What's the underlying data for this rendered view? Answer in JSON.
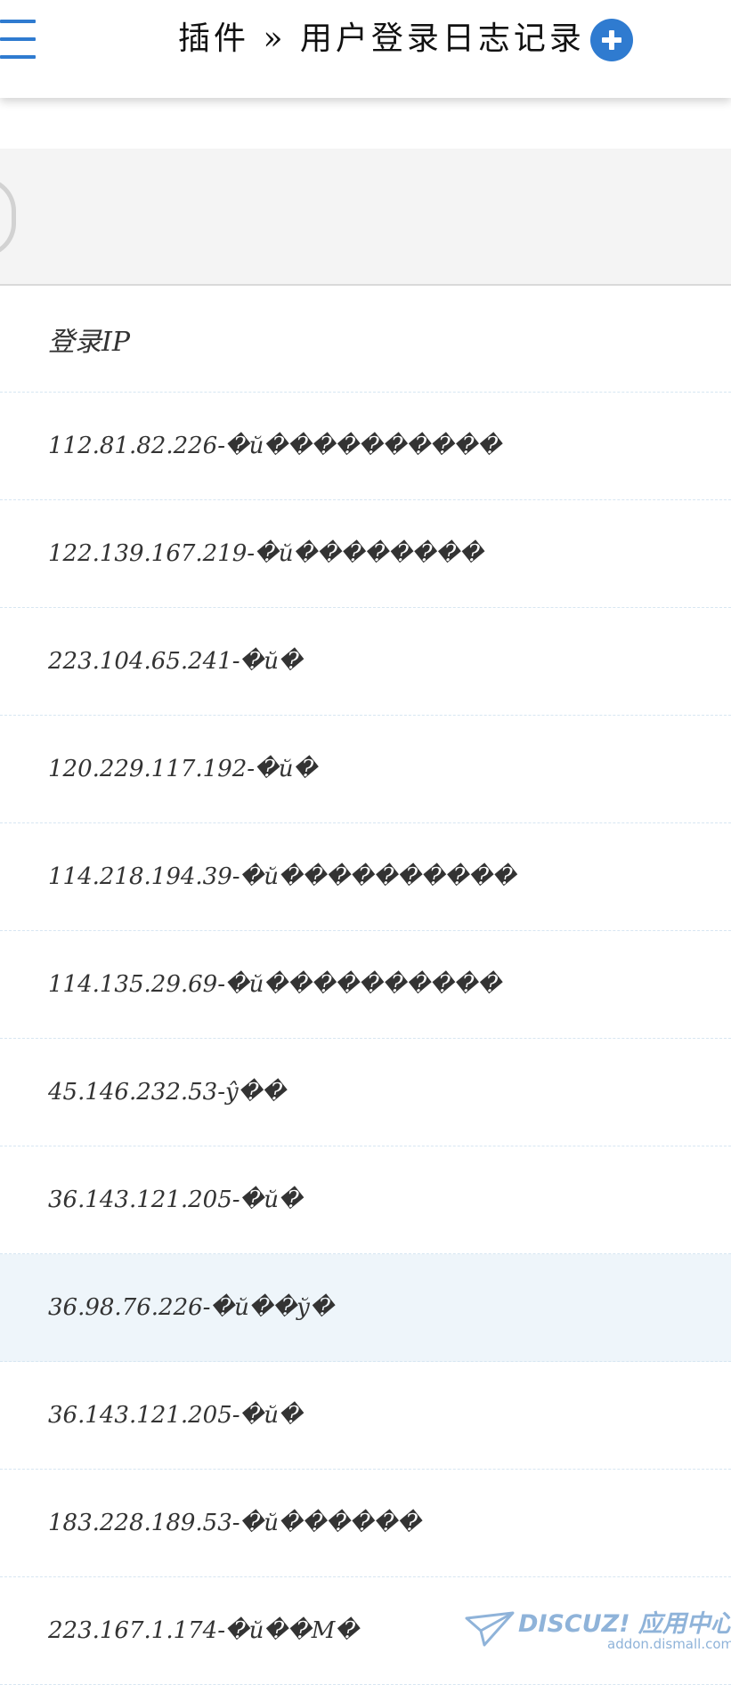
{
  "header": {
    "title": "插件 » 用户登录日志记录",
    "menu_icon": "hamburger-menu-icon",
    "add_icon": "plus-icon",
    "accent_color": "#2f7bd0"
  },
  "table": {
    "column_header": "登录IP",
    "rows": [
      "112.81.82.226-�й����������",
      "122.139.167.219-�й��������",
      "223.104.65.241-�й�",
      "120.229.117.192-�й�",
      "114.218.194.39-�й����������",
      "114.135.29.69-�й����������",
      "45.146.232.53-ŷ��",
      "36.143.121.205-�й�",
      "36.98.76.226-�й��ў�",
      "36.143.121.205-�й�",
      "183.228.189.53-�й������",
      "223.167.1.174-�й��М�"
    ],
    "highlighted_row_index": 8,
    "highlight_color": "#eef5fa"
  },
  "watermark": {
    "main": "DISCUZ! 应用中心",
    "sub": "addon.dismall.com"
  }
}
